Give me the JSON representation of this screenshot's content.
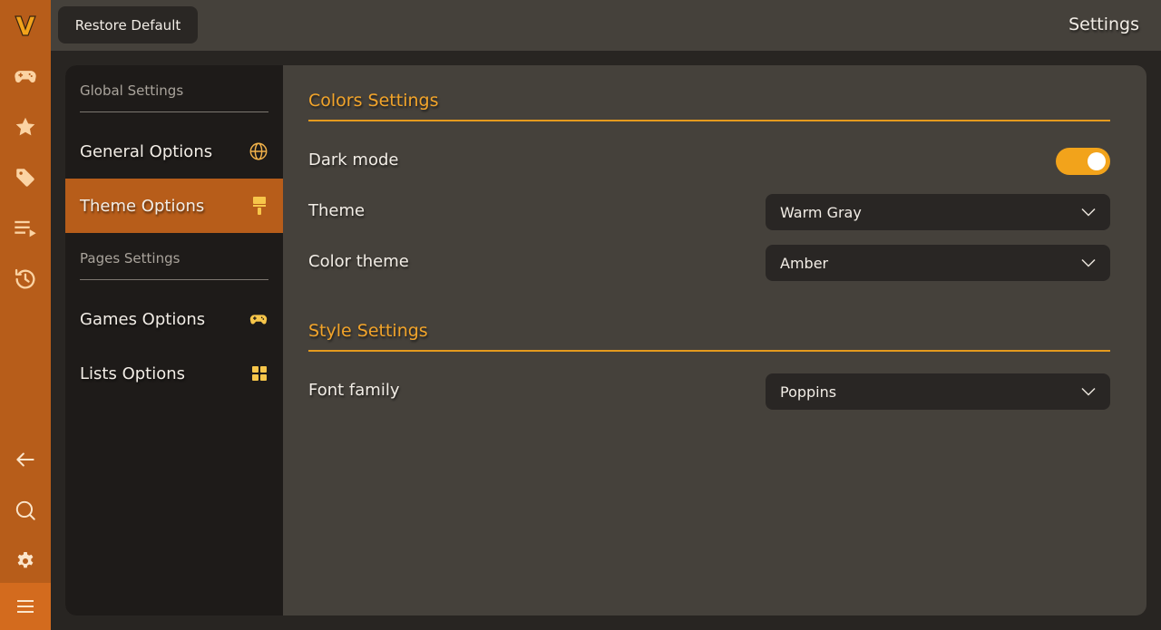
{
  "app": {
    "logo_letter": "V",
    "accent_color": "#f2a31b",
    "rail_color": "#b75d1a"
  },
  "rail": {
    "top_icons": [
      "gamepad-icon",
      "star-icon",
      "tag-icon",
      "playlist-icon",
      "history-icon"
    ],
    "bottom_icons": [
      "arrow-left-icon",
      "search-icon",
      "gear-icon",
      "menu-icon"
    ]
  },
  "topbar": {
    "restore_label": "Restore Default",
    "title": "Settings"
  },
  "sidebar": {
    "global_header": "Global Settings",
    "pages_header": "Pages Settings",
    "items": [
      {
        "label": "General Options",
        "icon": "globe-icon",
        "active": false
      },
      {
        "label": "Theme Options",
        "icon": "paint-brush-icon",
        "active": true
      },
      {
        "label": "Games Options",
        "icon": "gamepad-icon",
        "active": false
      },
      {
        "label": "Lists Options",
        "icon": "grid-icon",
        "active": false
      }
    ]
  },
  "colors_section": {
    "title": "Colors Settings",
    "dark_mode": {
      "label": "Dark mode",
      "value": true
    },
    "theme": {
      "label": "Theme",
      "value": "Warm Gray"
    },
    "color_theme": {
      "label": "Color theme",
      "value": "Amber"
    }
  },
  "style_section": {
    "title": "Style Settings",
    "font_family": {
      "label": "Font family",
      "value": "Poppins"
    }
  }
}
